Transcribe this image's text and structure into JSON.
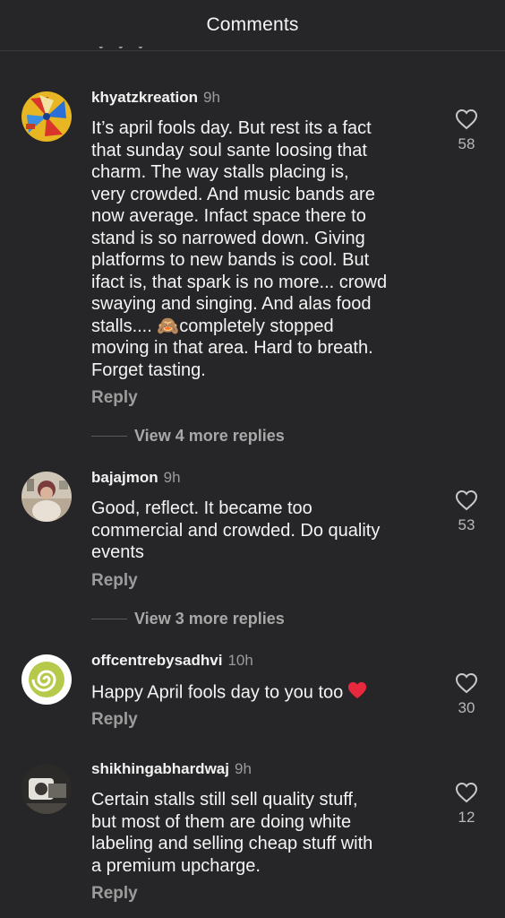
{
  "header": {
    "title": "Comments"
  },
  "comments": [
    {
      "username": "khyatzkreation",
      "time": "9h",
      "lines": [
        "It’s april fools day. But rest its a fact",
        "that sunday soul sante loosing that",
        "charm. The way stalls placing is,",
        "very crowded. And music bands are",
        "now average. Infact space there to",
        "stand is so narrowed down. Giving",
        "platforms to new bands is cool. But",
        "ifact is, that spark is no more... crowd",
        "swaying and singing. And alas food",
        "stalls.... 🙈completely stopped",
        "moving in that area. Hard to breath.",
        "Forget tasting."
      ],
      "reply_label": "Reply",
      "likes": "58",
      "view_more": "View 4 more replies",
      "avatar_icon": "pinwheel-avatar"
    },
    {
      "username": "bajajmon",
      "time": "9h",
      "lines": [
        "Good, reflect. It became too",
        "commercial and crowded. Do quality",
        "events"
      ],
      "reply_label": "Reply",
      "likes": "53",
      "view_more": "View 3 more replies",
      "avatar_icon": "person-photo-avatar"
    },
    {
      "username": "offcentrebysadhvi",
      "time": "10h",
      "lines": [
        "Happy April fools day to you too"
      ],
      "emoji": "red-heart",
      "reply_label": "Reply",
      "likes": "30",
      "avatar_icon": "spiral-avatar"
    },
    {
      "username": "shikhingabhardwaj",
      "time": "9h",
      "lines": [
        "Certain stalls still sell quality stuff,",
        "but most of them are doing white",
        "labeling and selling cheap stuff with",
        "a premium upcharge."
      ],
      "reply_label": "Reply",
      "likes": "12",
      "avatar_icon": "camera-photo-avatar"
    }
  ],
  "colors": {
    "background": "#262628",
    "text": "#f4f4f4",
    "muted": "#9c9c9c",
    "heart": "#e8283c"
  }
}
